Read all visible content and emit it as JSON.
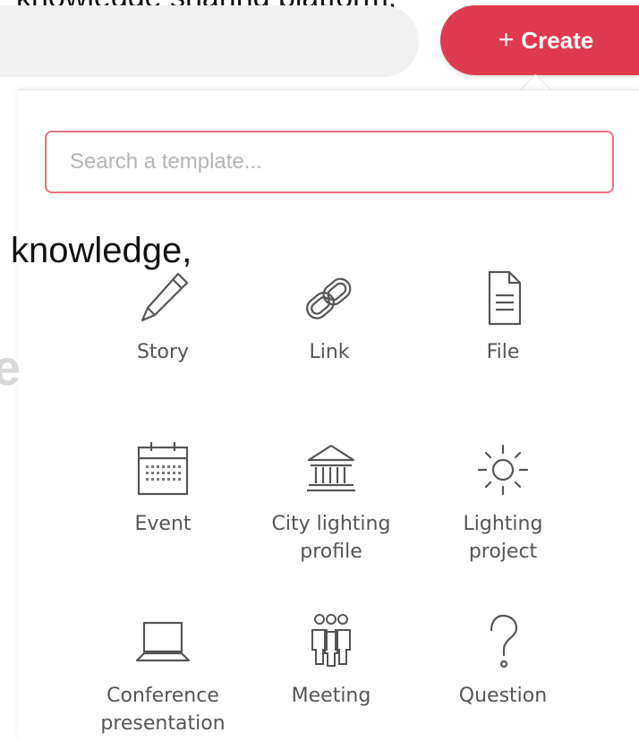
{
  "background": {
    "heading_fragment": "knowledge sharing platform.",
    "body_fragment": "knowledge,",
    "faded_fragment": "e"
  },
  "header": {
    "create_label": "Create",
    "create_icon": "plus-icon"
  },
  "dropdown": {
    "search": {
      "placeholder": "Search a template...",
      "value": ""
    },
    "templates": [
      {
        "label": "Story",
        "icon": "pencil-icon"
      },
      {
        "label": "Link",
        "icon": "chain-link-icon"
      },
      {
        "label": "File",
        "icon": "document-icon"
      },
      {
        "label": "Event",
        "icon": "calendar-icon"
      },
      {
        "label": "City lighting\nprofile",
        "icon": "government-building-icon"
      },
      {
        "label": "Lighting\nproject",
        "icon": "sun-icon"
      },
      {
        "label": "Conference\npresentation",
        "icon": "laptop-icon"
      },
      {
        "label": "Meeting",
        "icon": "people-group-icon"
      },
      {
        "label": "Question",
        "icon": "question-mark-icon"
      }
    ]
  },
  "colors": {
    "accent": "#e03a4e",
    "search_border": "#e8727f",
    "icon_stroke": "#555555"
  }
}
